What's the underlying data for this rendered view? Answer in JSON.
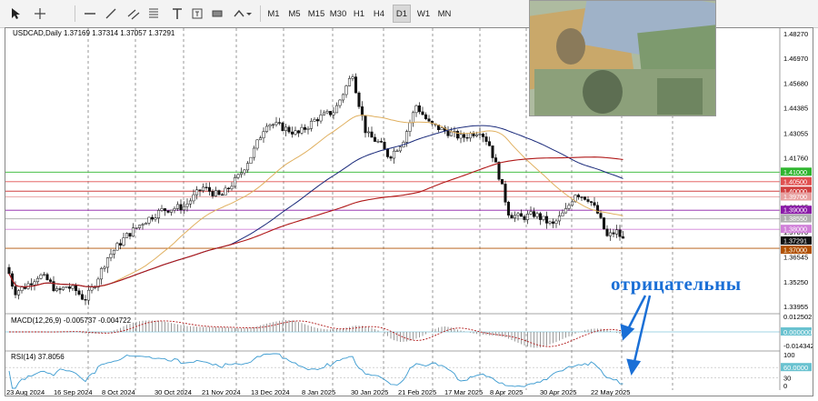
{
  "toolbar": {
    "timeframes": [
      "M1",
      "M5",
      "M15",
      "M30",
      "H1",
      "H4",
      "D1",
      "W1",
      "MN"
    ],
    "active_timeframe": "D1"
  },
  "chart": {
    "title": "USDCAD,Daily  1.37169 1.37314 1.37057 1.37291",
    "price_ticks": [
      "1.48270",
      "1.46970",
      "1.45680",
      "1.44385",
      "1.43055",
      "1.41760",
      "1.39165",
      "1.37870",
      "1.36545",
      "1.35250",
      "1.33955"
    ],
    "level_labels": [
      {
        "text": "1.41000",
        "color": "#2fb52f"
      },
      {
        "text": "1.40500",
        "color": "#e05050"
      },
      {
        "text": "1.40000",
        "color": "#d04040"
      },
      {
        "text": "1.39700",
        "color": "#e8a0a0"
      },
      {
        "text": "1.39000",
        "color": "#8a1aa8"
      },
      {
        "text": "1.38550",
        "color": "#b0b0b0"
      },
      {
        "text": "1.38000",
        "color": "#d080d8"
      },
      {
        "text": "1.37291",
        "color": "#111111"
      },
      {
        "text": "1.37000",
        "color": "#b05000"
      }
    ],
    "date_labels": [
      "23 Aug 2024",
      "16 Sep 2024",
      "8 Oct 2024",
      "30 Oct 2024",
      "21 Nov 2024",
      "13 Dec 2024",
      "8 Jan 2025",
      "30 Jan 2025",
      "21 Feb 2025",
      "17 Mar 2025",
      "8 Apr 2025",
      "30 Apr 2025",
      "22 May 2025"
    ]
  },
  "macd": {
    "title": "MACD(12,26,9) -0.005737 -0.004722",
    "ticks": [
      "0.012502",
      "0.000000",
      "-0.014342"
    ]
  },
  "rsi": {
    "title": "RSI(14) 37.8056",
    "ticks": [
      "100",
      "60.0000",
      "30",
      "0"
    ]
  },
  "annotation": {
    "text": "отрицательны",
    "color": "#1a6fd6"
  },
  "colors": {
    "candles": "#111111",
    "ma_fast": "#e0b060",
    "ma_mid": "#1a2a7a",
    "ma_slow": "#b01818",
    "macd_hist": "#9a9a9a",
    "macd_signal": "#b01818",
    "rsi_line": "#3a9ad0"
  }
}
